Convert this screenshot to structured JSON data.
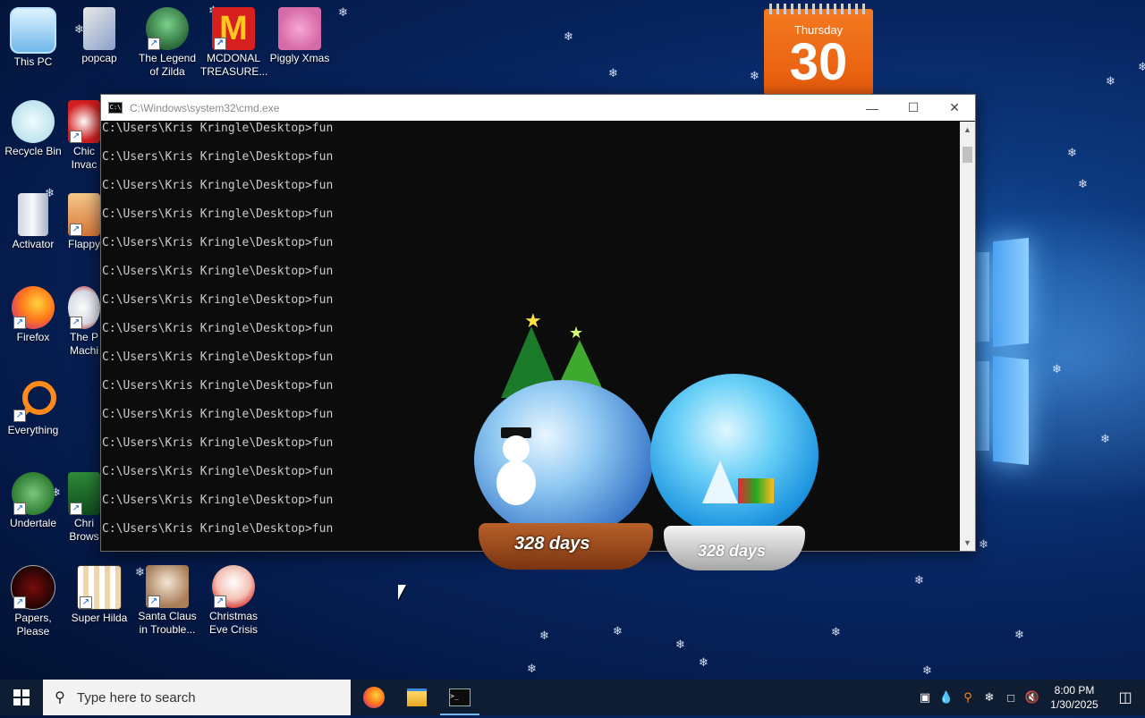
{
  "desktop": {
    "icons_col1": [
      {
        "label": "This PC"
      },
      {
        "label": "Recycle Bin"
      },
      {
        "label": "Activator"
      },
      {
        "label": "Firefox"
      },
      {
        "label": "Everything"
      },
      {
        "label": "Undertale"
      },
      {
        "label": "Papers, Please"
      }
    ],
    "icons_col2": [
      {
        "label": "popcap"
      },
      {
        "label": "Chic Invac"
      },
      {
        "label": "Flappy"
      },
      {
        "label": "The P Machi"
      },
      {
        "label": "Chri Brows"
      },
      {
        "label": "Super Hilda"
      }
    ],
    "icons_top": [
      {
        "label": "The Legend of Zilda"
      },
      {
        "label": "MCDONAL TREASURE..."
      },
      {
        "label": "Piggly Xmas"
      }
    ],
    "icons_bottom": [
      {
        "label": "Santa Claus in Trouble..."
      },
      {
        "label": "Christmas Eve Crisis"
      }
    ]
  },
  "calendar": {
    "weekday": "Thursday",
    "day": "30"
  },
  "cmd": {
    "title": "C:\\Windows\\system32\\cmd.exe",
    "prompt": "C:\\Users\\Kris Kringle\\Desktop>fun",
    "line_count": 15
  },
  "globes": {
    "left_days": "328 days",
    "right_days": "328 days"
  },
  "taskbar": {
    "search_placeholder": "Type here to search",
    "time": "8:00 PM",
    "date": "1/30/2025"
  },
  "colors": {
    "calendar_orange": "#e8650f",
    "taskbar": "#0f1d33",
    "cmd_bg": "#0c0c0c"
  }
}
